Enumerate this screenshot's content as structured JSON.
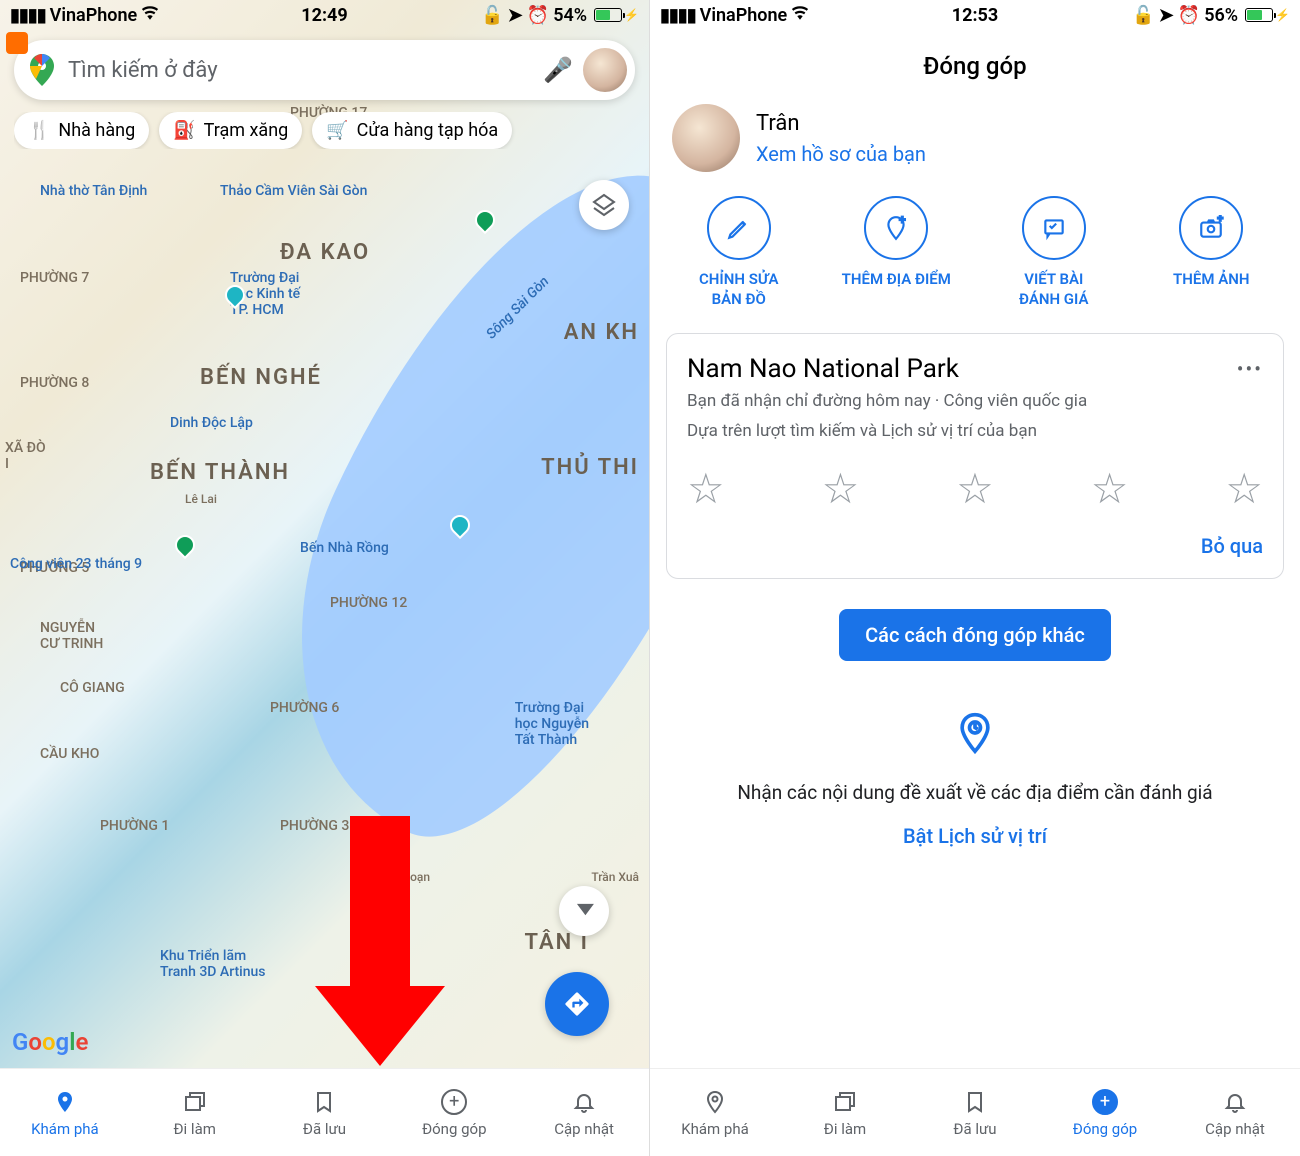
{
  "left": {
    "status": {
      "carrier": "VinaPhone",
      "time": "12:49",
      "battery": "54%"
    },
    "search": {
      "placeholder": "Tìm kiếm ở đây"
    },
    "chips": [
      {
        "icon": "🍴",
        "label": "Nhà hàng"
      },
      {
        "icon": "⛽",
        "label": "Trạm xăng"
      },
      {
        "icon": "🛒",
        "label": "Cửa hàng tạp hóa"
      }
    ],
    "map_labels": {
      "dakao": "ĐA KAO",
      "benthanh": "BẾN THÀNH",
      "bennghe": "BẾN NGHÉ",
      "thuthi": "THỦ THI",
      "ankh": "AN KH",
      "p17": "PHƯỜNG 17",
      "p7": "PHƯỜNG 7",
      "p8": "PHƯỜNG 8",
      "p5": "PHƯỜNG 5",
      "p12": "PHƯỜNG 12",
      "p6": "PHƯỜNG 6",
      "p3": "PHƯỜNG 3",
      "p1": "PHƯỜNG 1",
      "nguyencutrinh": "NGUYỄN\nCƯ TRINH",
      "cogiang": "CÔ GIANG",
      "caukho": "CẦU KHO",
      "tandinh": "Nhà thờ Tân Định",
      "thao": "Thảo Cầm Viên Sài Gòn",
      "truongdh": "Trường Đại\nhọc Kinh tế\nTP. HCM",
      "dinh": "Dinh Độc Lập",
      "lelai": "Lê Lai",
      "congvien": "Công viên 23 tháng 9",
      "bennharong": "Bến Nhà Rồng",
      "truongnt": "Trường Đại\nhọc Nguyễn\nTất Thành",
      "khutrien": "Khu Triển lãm\nTranh 3D Artinus",
      "songsg": "Sông Sài Gòn",
      "tann": "TÂN I",
      "xado": "XÃ ĐÒ\nI",
      "tuansoan": "uần Soạn",
      "tranxua": "Trần Xuâ"
    },
    "nav": [
      "Khám phá",
      "Đi làm",
      "Đã lưu",
      "Đóng góp",
      "Cập nhật"
    ]
  },
  "right": {
    "status": {
      "carrier": "VinaPhone",
      "time": "12:53",
      "battery": "56%"
    },
    "title": "Đóng góp",
    "profile": {
      "name": "Trân",
      "link": "Xem hồ sơ của bạn"
    },
    "actions": [
      {
        "label": "CHỈNH SỬA\nBẢN ĐỒ"
      },
      {
        "label": "THÊM ĐỊA ĐIỂM"
      },
      {
        "label": "VIẾT BÀI\nĐÁNH GIÁ"
      },
      {
        "label": "THÊM ẢNH"
      }
    ],
    "card": {
      "title": "Nam Nao National Park",
      "sub1": "Bạn đã nhận chỉ đường hôm nay · Công viên quốc gia",
      "sub2": "Dựa trên lượt tìm kiếm và Lịch sử vị trí của bạn",
      "skip": "Bỏ qua"
    },
    "more_btn": "Các cách đóng góp khác",
    "suggest": {
      "text": "Nhận các nội dung đề xuất về các địa điểm cần đánh giá",
      "link": "Bật Lịch sử vị trí"
    },
    "nav": [
      "Khám phá",
      "Đi làm",
      "Đã lưu",
      "Đóng góp",
      "Cập nhật"
    ]
  }
}
